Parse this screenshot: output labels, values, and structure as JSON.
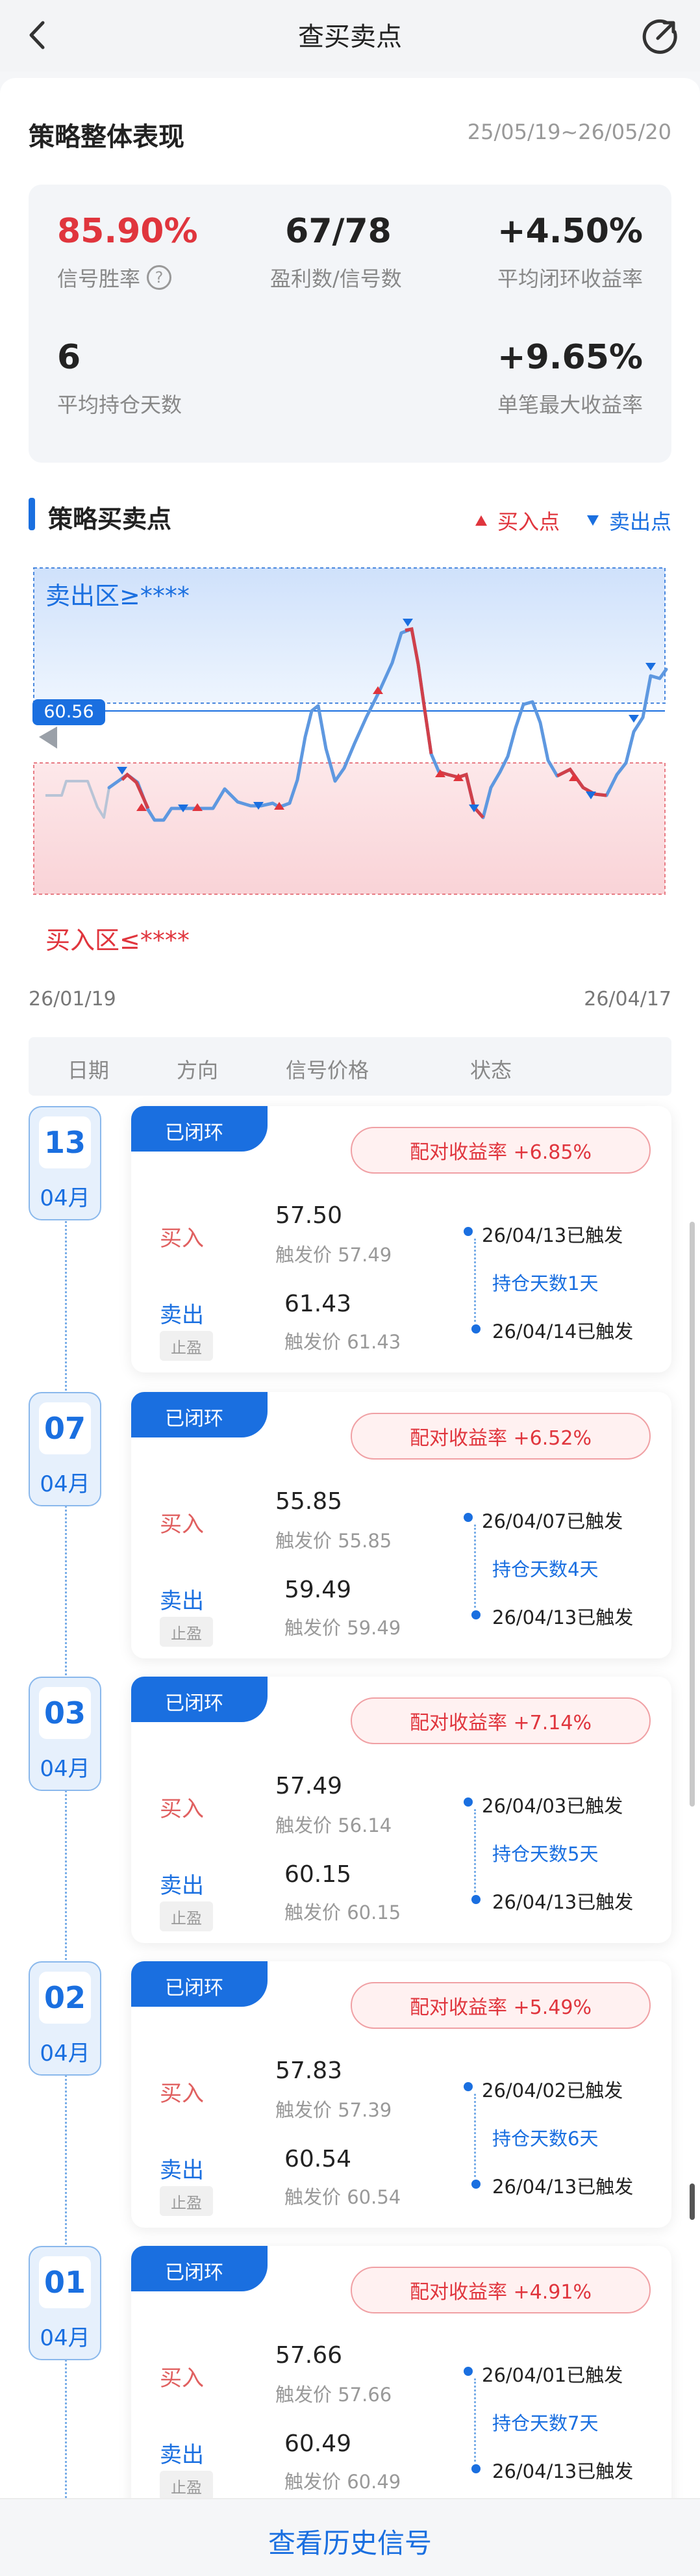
{
  "header": {
    "title": "查买卖点"
  },
  "performance": {
    "title": "策略整体表现",
    "range": "25/05/19~26/05/20",
    "stats": [
      {
        "value": "85.90%",
        "label": "信号胜率"
      },
      {
        "value": "67/78",
        "label": "盈利数/信号数"
      },
      {
        "value": "+4.50%",
        "label": "平均闭环收益率"
      },
      {
        "value": "6",
        "label": "平均持仓天数"
      },
      {
        "value": "+9.65%",
        "label": "单笔最大收益率"
      }
    ]
  },
  "signals": {
    "title": "策略买卖点",
    "legend_buy": "买入点",
    "legend_sell": "卖出点"
  },
  "chart_data": {
    "type": "line",
    "sell_zone_label": "卖出区≥****",
    "buy_zone_label": "买入区≤****",
    "current_price_label": "60.56",
    "x_start": "26/01/19",
    "x_end": "26/04/17"
  },
  "table_head": {
    "date": "日期",
    "direction": "方向",
    "price": "信号价格",
    "status": "状态"
  },
  "records": [
    {
      "day": "13",
      "month": "04月",
      "status": "已闭环",
      "yield": "配对收益率 +6.85%",
      "buy_label": "买入",
      "buy_price": "57.50",
      "buy_trigger": "触发价 57.49",
      "sell_label": "卖出",
      "sell_tag": "止盈",
      "sell_price": "61.43",
      "sell_trigger": "触发价 61.43",
      "buy_time": "26/04/13已触发",
      "hold": "持仓天数1天",
      "sell_time": "26/04/14已触发"
    },
    {
      "day": "07",
      "month": "04月",
      "status": "已闭环",
      "yield": "配对收益率 +6.52%",
      "buy_label": "买入",
      "buy_price": "55.85",
      "buy_trigger": "触发价 55.85",
      "sell_label": "卖出",
      "sell_tag": "止盈",
      "sell_price": "59.49",
      "sell_trigger": "触发价 59.49",
      "buy_time": "26/04/07已触发",
      "hold": "持仓天数4天",
      "sell_time": "26/04/13已触发"
    },
    {
      "day": "03",
      "month": "04月",
      "status": "已闭环",
      "yield": "配对收益率 +7.14%",
      "buy_label": "买入",
      "buy_price": "57.49",
      "buy_trigger": "触发价 56.14",
      "sell_label": "卖出",
      "sell_tag": "止盈",
      "sell_price": "60.15",
      "sell_trigger": "触发价 60.15",
      "buy_time": "26/04/03已触发",
      "hold": "持仓天数5天",
      "sell_time": "26/04/13已触发"
    },
    {
      "day": "02",
      "month": "04月",
      "status": "已闭环",
      "yield": "配对收益率 +5.49%",
      "buy_label": "买入",
      "buy_price": "57.83",
      "buy_trigger": "触发价 57.39",
      "sell_label": "卖出",
      "sell_tag": "止盈",
      "sell_price": "60.54",
      "sell_trigger": "触发价 60.54",
      "buy_time": "26/04/02已触发",
      "hold": "持仓天数6天",
      "sell_time": "26/04/13已触发"
    },
    {
      "day": "01",
      "month": "04月",
      "status": "已闭环",
      "yield": "配对收益率 +4.91%",
      "buy_label": "买入",
      "buy_price": "57.66",
      "buy_trigger": "触发价 57.66",
      "sell_label": "卖出",
      "sell_tag": "止盈",
      "sell_price": "60.49",
      "sell_trigger": "触发价 60.49",
      "buy_time": "26/04/01已触发",
      "hold": "持仓天数7天",
      "sell_time": "26/04/13已触发"
    }
  ],
  "footer": {
    "history": "查看历史信号"
  }
}
